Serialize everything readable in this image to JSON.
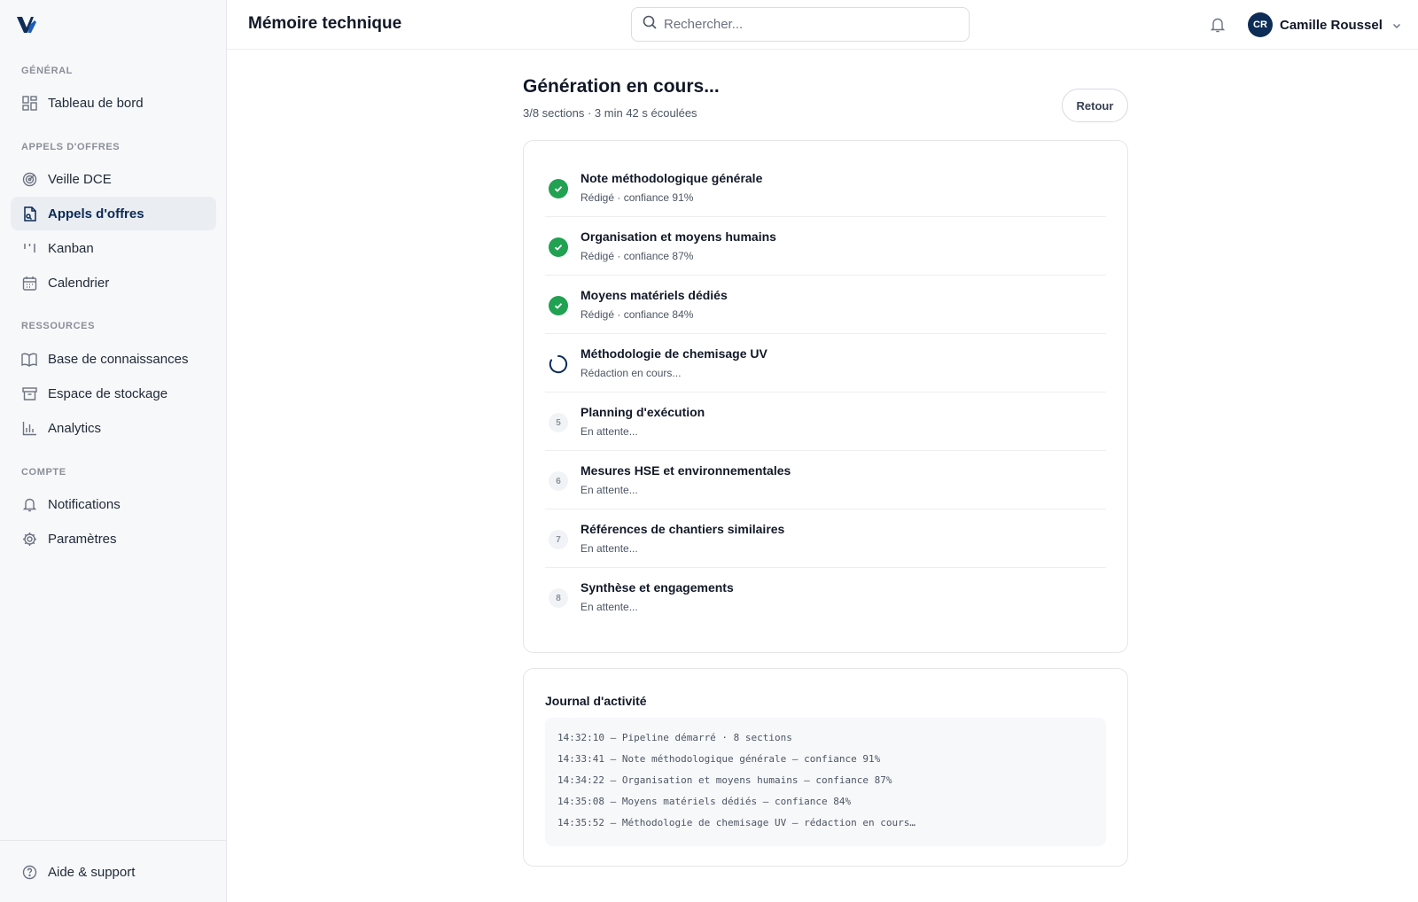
{
  "app": {
    "title": "Mémoire technique",
    "search_placeholder": "Rechercher...",
    "user": {
      "initials": "CR",
      "name": "Camille Roussel"
    },
    "colors": {
      "brand": "#0d2d57",
      "success": "#21a152",
      "active_bg": "#eaedf2"
    }
  },
  "sidebar": {
    "sections": [
      {
        "label": "GÉNÉRAL",
        "items": [
          {
            "label": "Tableau de bord",
            "icon": "dashboard-icon"
          }
        ]
      },
      {
        "label": "APPELS D'OFFRES",
        "items": [
          {
            "label": "Veille DCE",
            "icon": "radar-icon"
          },
          {
            "label": "Appels d'offres",
            "icon": "document-icon",
            "active": true
          },
          {
            "label": "Kanban",
            "icon": "kanban-icon"
          },
          {
            "label": "Calendrier",
            "icon": "calendar-icon"
          }
        ]
      },
      {
        "label": "RESSOURCES",
        "items": [
          {
            "label": "Base de connaissances",
            "icon": "book-icon"
          },
          {
            "label": "Espace de stockage",
            "icon": "archive-icon"
          },
          {
            "label": "Analytics",
            "icon": "bar-chart-icon"
          }
        ]
      },
      {
        "label": "COMPTE",
        "items": [
          {
            "label": "Notifications",
            "icon": "bell-icon"
          },
          {
            "label": "Paramètres",
            "icon": "gear-icon"
          }
        ]
      }
    ],
    "footer": {
      "label": "Aide & support",
      "icon": "help-icon"
    }
  },
  "generation": {
    "title": "Génération en cours...",
    "subtitle": "3/8 sections · 3 min 42 s écoulées",
    "back_label": "Retour",
    "sections": [
      {
        "name": "Note méthodologique générale",
        "detail": "Rédigé · confiance 91%",
        "status": "done",
        "number": "1"
      },
      {
        "name": "Organisation et moyens humains",
        "detail": "Rédigé · confiance 87%",
        "status": "done",
        "number": "2"
      },
      {
        "name": "Moyens matériels dédiés",
        "detail": "Rédigé · confiance 84%",
        "status": "done",
        "number": "3"
      },
      {
        "name": "Méthodologie de chemisage UV",
        "detail": "Rédaction en cours...",
        "status": "running",
        "number": "4"
      },
      {
        "name": "Planning d'exécution",
        "detail": "En attente...",
        "status": "pending",
        "number": "5"
      },
      {
        "name": "Mesures HSE et environnementales",
        "detail": "En attente...",
        "status": "pending",
        "number": "6"
      },
      {
        "name": "Références de chantiers similaires",
        "detail": "En attente...",
        "status": "pending",
        "number": "7"
      },
      {
        "name": "Synthèse et engagements",
        "detail": "En attente...",
        "status": "pending",
        "number": "8"
      }
    ]
  },
  "journal": {
    "title": "Journal d'activité",
    "lines": [
      "14:32:10 — Pipeline démarré · 8 sections",
      "14:33:41 — Note méthodologique générale — confiance 91%",
      "14:34:22 — Organisation et moyens humains — confiance 87%",
      "14:35:08 — Moyens matériels dédiés — confiance 84%",
      "14:35:52 — Méthodologie de chemisage UV — rédaction en cours…"
    ]
  }
}
